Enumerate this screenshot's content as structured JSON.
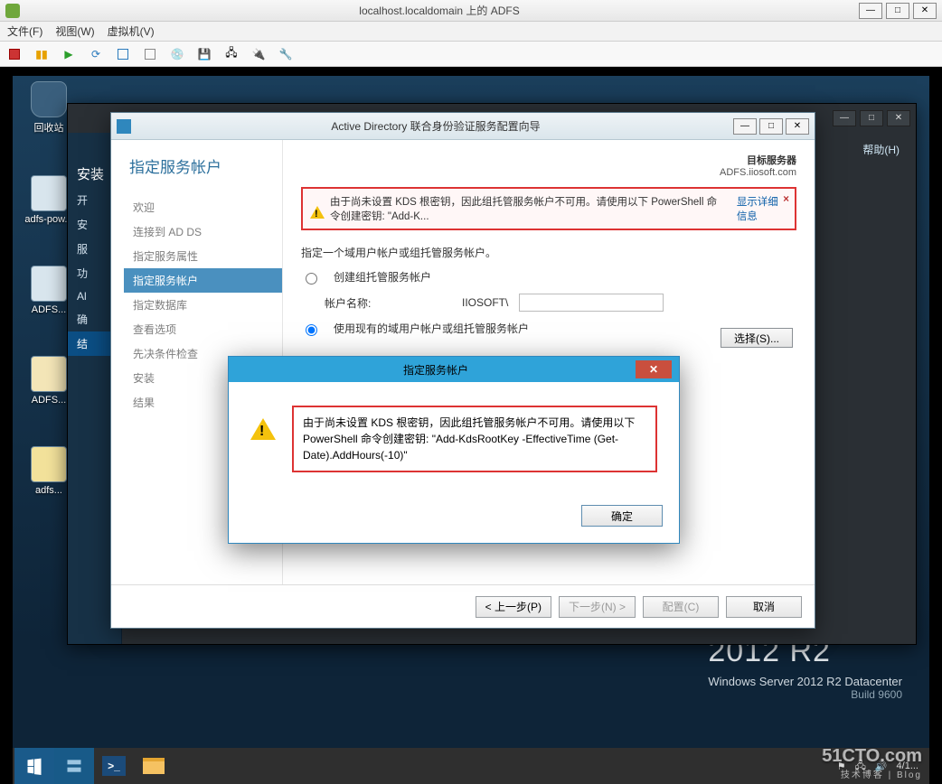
{
  "vm": {
    "title": "localhost.localdomain 上的 ADFS",
    "menu": {
      "file": "文件(F)",
      "view": "视图(W)",
      "vm": "虚拟机(V)"
    }
  },
  "bgwin": {
    "help": "帮助(H)",
    "side": {
      "i0": "安装",
      "i1": "开",
      "i2": "安",
      "i3": "服",
      "i4": "功",
      "i5": "Al",
      "i6": "确",
      "i7": "结"
    }
  },
  "desktop": {
    "icons": {
      "bin": "回收站",
      "adfspow": "adfs-pow...",
      "adfs1": "ADFS...",
      "adfs2": "ADFS...",
      "adfs3": "adfs..."
    },
    "brand_big": "2012 R2",
    "brand_line": "Windows Server 2012 R2 Datacenter",
    "brand_build": "Build 9600"
  },
  "wizard": {
    "title": "Active Directory 联合身份验证服务配置向导",
    "heading": "指定服务帐户",
    "target_label": "目标服务器",
    "target_host": "ADFS.iiosoft.com",
    "steps": {
      "s0": "欢迎",
      "s1": "连接到 AD DS",
      "s2": "指定服务属性",
      "s3": "指定服务帐户",
      "s4": "指定数据库",
      "s5": "查看选项",
      "s6": "先决条件检查",
      "s7": "安装",
      "s8": "结果"
    },
    "warn_text": "由于尚未设置 KDS 根密钥，因此组托管服务帐户不可用。请使用以下 PowerShell 命令创建密钥: \"Add-K...",
    "warn_more": "显示详细信息",
    "desc": "指定一个域用户帐户或组托管服务帐户。",
    "radio_create": "创建组托管服务帐户",
    "acct_name_label": "帐户名称:",
    "acct_prefix": "IIOSOFT\\",
    "radio_existing": "使用现有的域用户帐户或组托管服务帐户",
    "select_btn": "选择(S)...",
    "btn_prev": "< 上一步(P)",
    "btn_next": "下一步(N) >",
    "btn_config": "配置(C)",
    "btn_cancel": "取消"
  },
  "msgbox": {
    "title": "指定服务帐户",
    "text": "由于尚未设置 KDS 根密钥，因此组托管服务帐户不可用。请使用以下 PowerShell 命令创建密钥: \"Add-KdsRootKey -EffectiveTime (Get-Date).AddHours(-10)\"",
    "ok": "确定"
  },
  "taskbar": {
    "time": "4/1...",
    "watermark_big": "51CTO.com",
    "watermark_sm": "技术博客 | Blog"
  }
}
